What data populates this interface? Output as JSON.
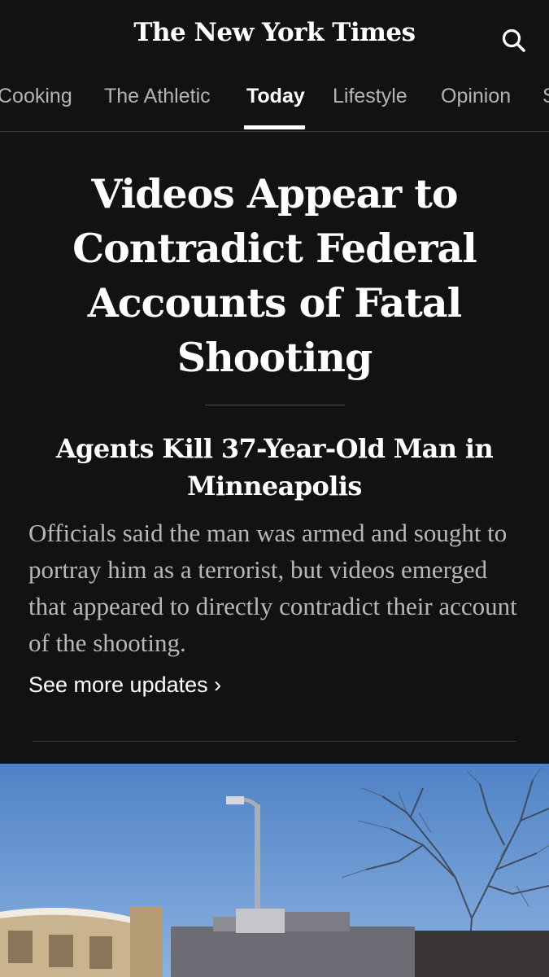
{
  "header": {
    "logo_text": "The New York Times",
    "search_icon": "search-icon"
  },
  "tabs": [
    {
      "label": "Cooking",
      "active": false
    },
    {
      "label": "The Athletic",
      "active": false
    },
    {
      "label": "Today",
      "active": true
    },
    {
      "label": "Lifestyle",
      "active": false
    },
    {
      "label": "Opinion",
      "active": false
    },
    {
      "label": "S",
      "active": false
    }
  ],
  "article": {
    "headline": "Videos Appear to Contradict Federal Accounts of Fatal Shooting",
    "subheadline": "Agents Kill 37-Year-Old Man in Minneapolis",
    "summary": "Officials said the man was armed and sought to portray him as a terrorist, but videos emerged that appeared to directly contradict their account of the shooting.",
    "updates_link": "See more updates ›"
  },
  "colors": {
    "background": "#121212",
    "text": "#ffffff",
    "muted_text": "#b8b8b8",
    "divider": "#3a3a3a"
  }
}
